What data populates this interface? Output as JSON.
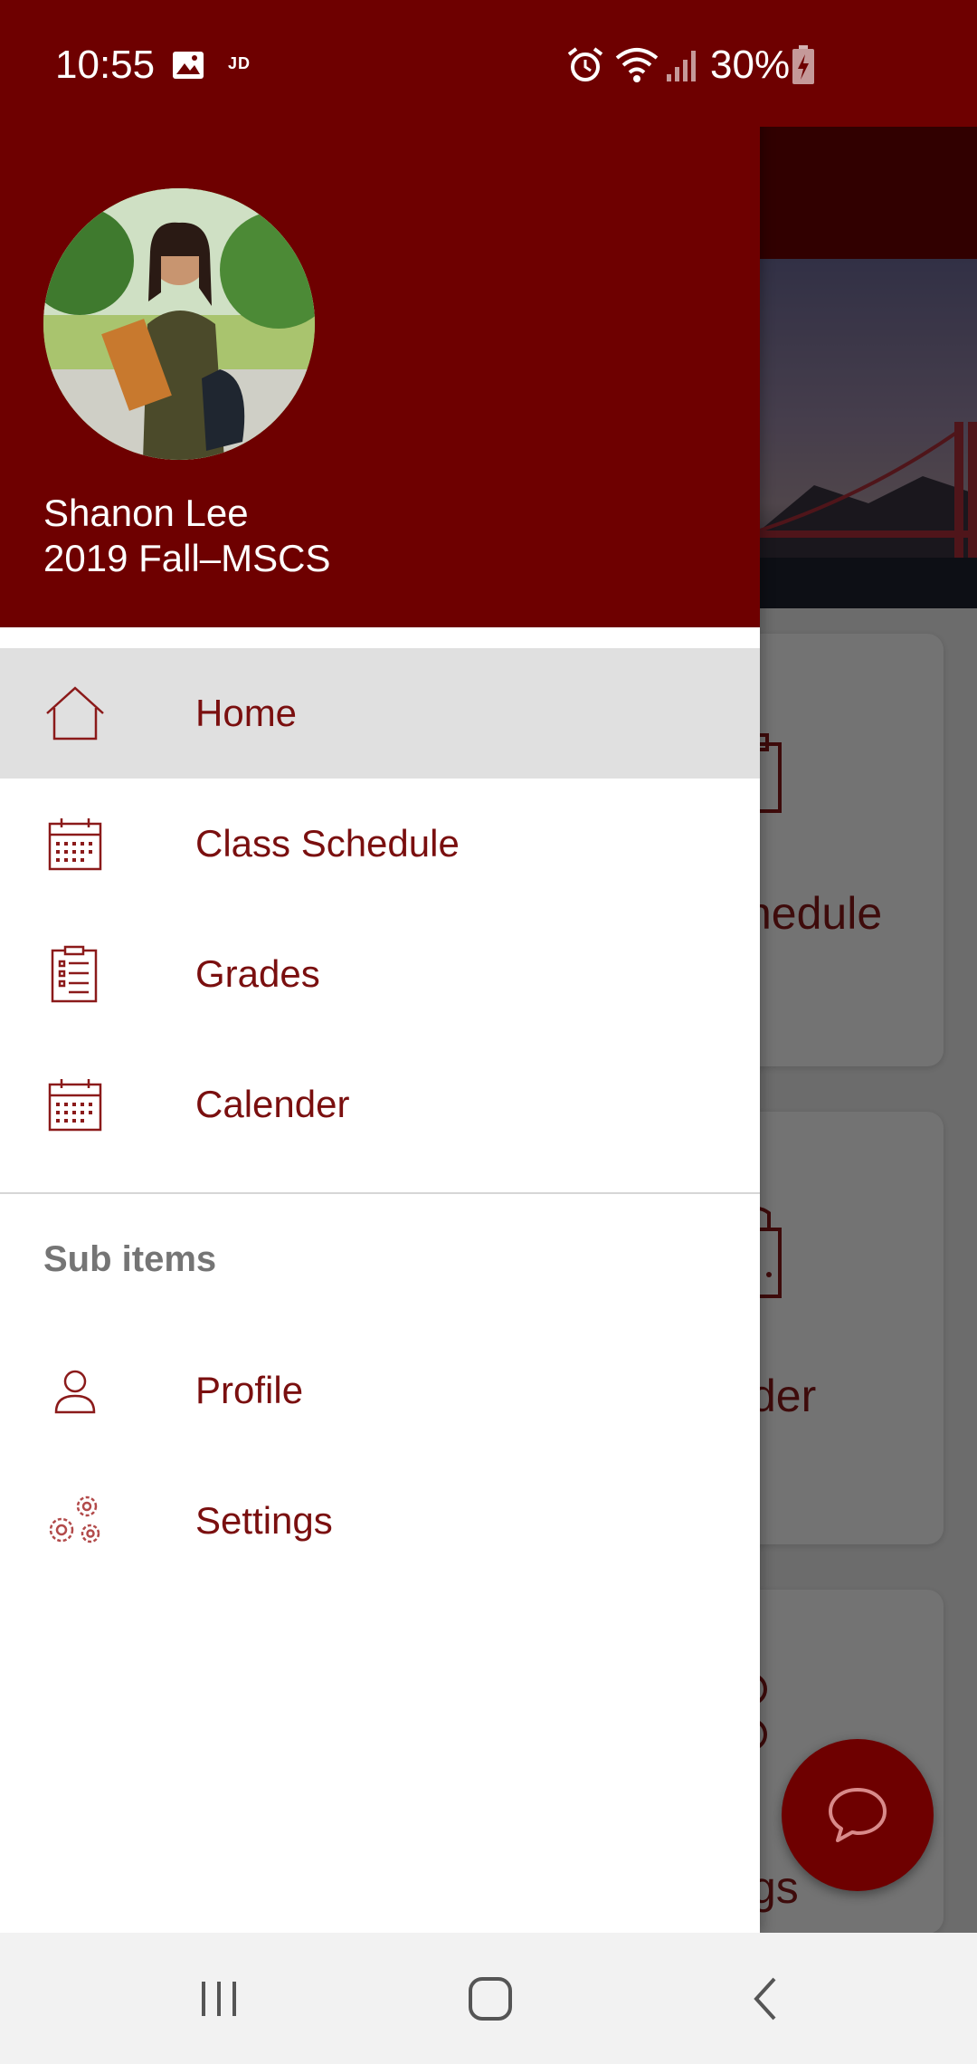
{
  "status_bar": {
    "time": "10:55",
    "jd_label": "JD",
    "battery_percent": "30%",
    "icons": [
      "image-icon",
      "alarm-icon",
      "wifi-icon",
      "signal-icon",
      "battery-charging-icon"
    ]
  },
  "background_app": {
    "cards": [
      {
        "label_fragment": "hedule",
        "icon": "clipboard-icon"
      },
      {
        "label_fragment": "der",
        "icon": "bag-icon"
      },
      {
        "label_fragment": "gs",
        "icon": "gear-icon"
      }
    ],
    "fab_icon": "chat-bubble-icon"
  },
  "drawer": {
    "user": {
      "name": "Shanon Lee",
      "program": "2019 Fall–MSCS"
    },
    "menu": [
      {
        "label": "Home",
        "icon": "home-icon",
        "active": true
      },
      {
        "label": "Class Schedule",
        "icon": "calendar-icon",
        "active": false
      },
      {
        "label": "Grades",
        "icon": "clipboard-list-icon",
        "active": false
      },
      {
        "label": "Calender",
        "icon": "calendar-icon",
        "active": false
      }
    ],
    "section_header": "Sub items",
    "sub_menu": [
      {
        "label": "Profile",
        "icon": "person-icon"
      },
      {
        "label": "Settings",
        "icon": "gears-icon"
      }
    ]
  },
  "nav_bar": {
    "buttons": [
      "recent-apps-icon",
      "home-button-icon",
      "back-icon"
    ]
  },
  "colors": {
    "brand": "#6e0000",
    "menu_text": "#7a0f0f",
    "active_bg": "#e0e0e0",
    "section_text": "#757575"
  }
}
